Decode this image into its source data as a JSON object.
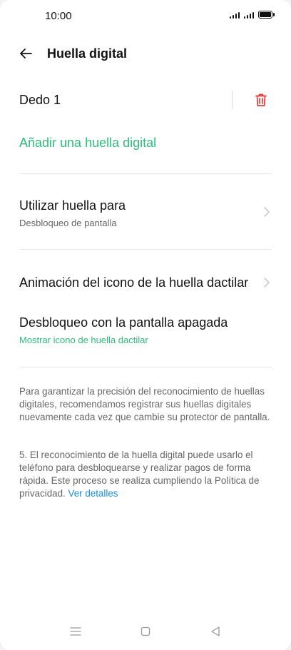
{
  "status_bar": {
    "time": "10:00"
  },
  "header": {
    "title": "Huella digital",
    "back_icon": "arrow-left"
  },
  "finger": {
    "name": "Dedo 1",
    "delete_icon": "trash"
  },
  "add_fingerprint": "Añadir una huella digital",
  "use_fingerprint": {
    "title": "Utilizar huella para",
    "subtitle": "Desbloqueo de pantalla"
  },
  "animation": {
    "title": "Animación del icono de la huella dactilar"
  },
  "screen_off_unlock": {
    "title": "Desbloqueo con la pantalla apagada",
    "subtitle": "Mostrar icono de huella dactilar"
  },
  "notes": {
    "para1": "Para garantizar la precisión del reconocimiento de huellas digitales, recomendamos registrar sus huellas digitales nuevamente cada vez que cambie su protector de pantalla.",
    "para2": "5. El reconocimiento de la huella digital puede usarlo el teléfono para desbloquearse y realizar pagos de forma rápida. Este proceso se realiza cumpliendo la Política de privacidad.",
    "details_link": "Ver detalles"
  },
  "colors": {
    "accent_green": "#2ebd7a",
    "delete_red": "#e03a3a",
    "link_blue": "#1a8ee6"
  },
  "nav_bar": {
    "icons": [
      "menu-icon",
      "home-icon",
      "back-triangle-icon"
    ]
  }
}
